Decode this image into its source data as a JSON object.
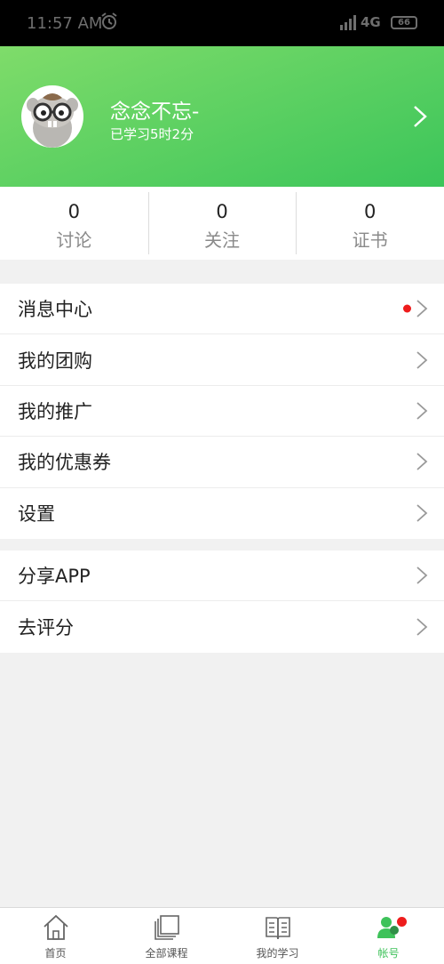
{
  "status_bar": {
    "time": "11:57 AM",
    "network": "4G",
    "battery": "66"
  },
  "profile": {
    "name": "念念不忘-",
    "study_time": "已学习5时2分"
  },
  "stats": [
    {
      "value": "0",
      "label": "讨论"
    },
    {
      "value": "0",
      "label": "关注"
    },
    {
      "value": "0",
      "label": "证书"
    }
  ],
  "menu_group_1": [
    {
      "label": "消息中心",
      "has_badge": true
    },
    {
      "label": "我的团购"
    },
    {
      "label": "我的推广"
    },
    {
      "label": "我的优惠券"
    },
    {
      "label": "设置"
    }
  ],
  "menu_group_2": [
    {
      "label": "分享APP"
    },
    {
      "label": "去评分"
    }
  ],
  "tabbar": [
    {
      "label": "首页",
      "icon": "home-icon"
    },
    {
      "label": "全部课程",
      "icon": "courses-icon"
    },
    {
      "label": "我的学习",
      "icon": "book-icon"
    },
    {
      "label": "帐号",
      "icon": "account-icon",
      "active": true
    }
  ],
  "colors": {
    "accent": "#3ec25a",
    "header_start": "#7fdc6a",
    "header_end": "#3bc55a",
    "badge": "#ee1c1c"
  }
}
